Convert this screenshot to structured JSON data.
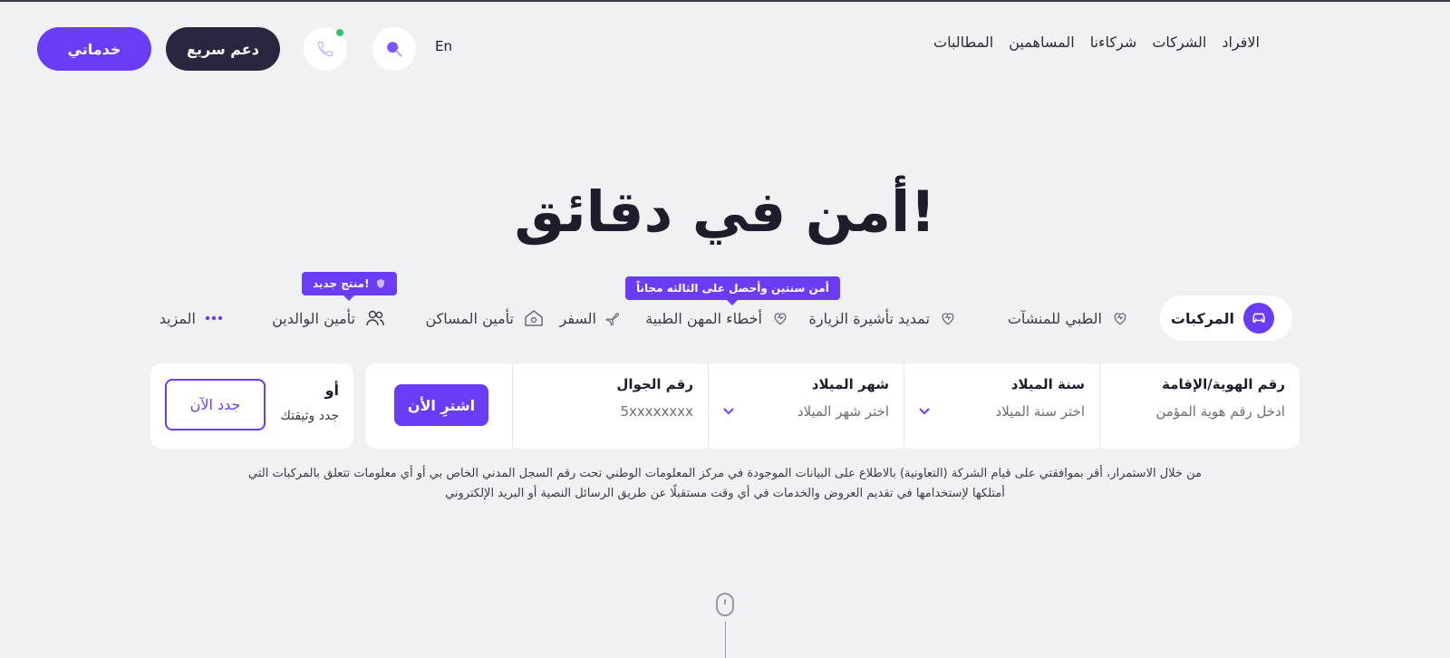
{
  "header": {
    "services_label": "خدماتي",
    "support_label": "دعم سريع",
    "lang_label": "En",
    "nav": [
      "الافراد",
      "الشركات",
      "شركاءنا",
      "المساهمين",
      "المطالبات"
    ]
  },
  "hero": {
    "title": "أمن في دقائق!"
  },
  "tabs": {
    "vehicles": "المركبات",
    "medical_facilities": "الطبي للمنشآت",
    "visit_visa": "تمديد تأشيرة الزيارة",
    "medical_malpractice": "أخطاء المهن الطبية",
    "travel": "السفر",
    "home": "تأمين المساكن",
    "parents": "تأمين الوالدين",
    "more": "المزيد",
    "tooltip_malpractice": "أمن سنتين وأحصل على الثالثه مجاناً",
    "tooltip_new": "منتج جديد!"
  },
  "form": {
    "id_label": "رقم الهوية/الإقامة",
    "id_placeholder": "ادخل رقم هوية المؤمن",
    "year_label": "سنة الميلاد",
    "year_placeholder": "اختر سنة الميلاد",
    "month_label": "شهر الميلاد",
    "month_placeholder": "اختر شهر الميلاد",
    "mobile_label": "رقم الجوال",
    "mobile_placeholder": "5xxxxxxxx",
    "buy_label": "اشترِ الأن"
  },
  "renew": {
    "or_label": "أو",
    "sub_label": "جدد وثيقتك",
    "button_label": "جدد الآن"
  },
  "consent": {
    "line1": "من خلال الاستمرار، أقر بموافقتي على قيام الشركة (التعاونية) بالاطلاع على البيانات الموجودة في مركز المعلومات الوطني تحت رقم السجل المدني الخاص بي أو أي معلومات تتعلق بالمركبات التي",
    "line2": "أمتلكها لإستخدامها في تقديم العروض والخدمات في أي وقت مستقبلًا عن طريق الرسائل النصية أو البريد الإلكتروني"
  },
  "colors": {
    "accent": "#6b3cf5",
    "dark": "#2b2640",
    "background": "#f0f1f3",
    "online": "#35c46a"
  }
}
